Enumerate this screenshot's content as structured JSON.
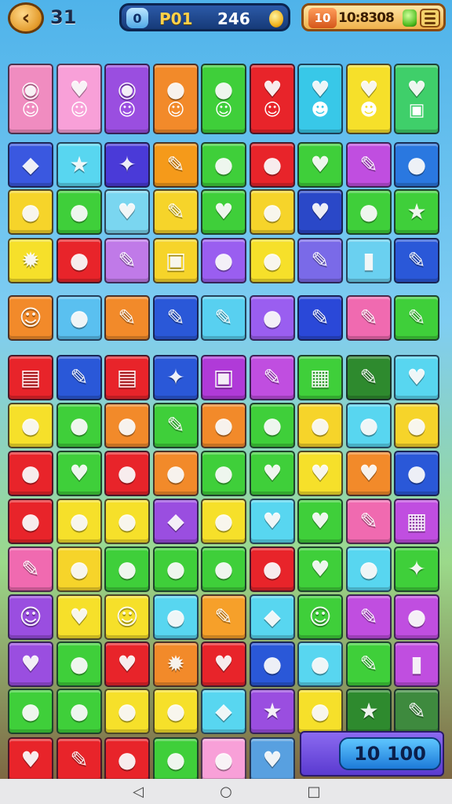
{
  "hud": {
    "level": "31",
    "mode_badge": "0",
    "mode_label": "P01",
    "score": "246",
    "timer_badge": "10",
    "timer": "10:8308",
    "back_icon": "back-arrow-icon",
    "coin_icon": "coin-icon",
    "gem_icon": "gem-icon",
    "menu_icon": "menu-icon"
  },
  "board": {
    "row_tops": [
      0,
      100,
      160,
      222,
      295,
      371,
      432,
      493,
      554,
      615,
      676,
      736,
      796,
      858
    ],
    "rows": [
      [
        {
          "color": "#f08cc0",
          "glyph": "◉",
          "face": "☺",
          "tall": true
        },
        {
          "color": "#f8a0d8",
          "glyph": "♥",
          "face": "☺",
          "tall": true
        },
        {
          "color": "#9a4ee0",
          "glyph": "◉",
          "face": "☺",
          "tall": true
        },
        {
          "color": "#f28a2a",
          "glyph": "●",
          "face": "☺",
          "tall": true
        },
        {
          "color": "#3fcf3a",
          "glyph": "●",
          "face": "☺",
          "tall": true
        },
        {
          "color": "#e8242a",
          "glyph": "♥",
          "face": "☺",
          "tall": true
        },
        {
          "color": "#38c8e8",
          "glyph": "♥",
          "face": "☻",
          "tall": true
        },
        {
          "color": "#f6e02a",
          "glyph": "♥",
          "face": "☻",
          "tall": true
        },
        {
          "color": "#3fcf6a",
          "glyph": "♥",
          "face": "▣",
          "tall": true
        }
      ],
      [
        {
          "color": "#3a58e0",
          "glyph": "◆"
        },
        {
          "color": "#58d6f0",
          "glyph": "★"
        },
        {
          "color": "#4a3ad8",
          "glyph": "✦"
        },
        {
          "color": "#f59a1a",
          "glyph": "✎"
        },
        {
          "color": "#3fcf3a",
          "glyph": "●"
        },
        {
          "color": "#e8242a",
          "glyph": "●"
        },
        {
          "color": "#3fcf3a",
          "glyph": "♥"
        },
        {
          "color": "#c04ee0",
          "glyph": "✎"
        },
        {
          "color": "#2a78e0",
          "glyph": "●"
        }
      ],
      [
        {
          "color": "#f6d42a",
          "glyph": "●"
        },
        {
          "color": "#3fcf3a",
          "glyph": "●"
        },
        {
          "color": "#7ad6f0",
          "glyph": "♥"
        },
        {
          "color": "#f6d42a",
          "glyph": "✎"
        },
        {
          "color": "#3fcf3a",
          "glyph": "♥"
        },
        {
          "color": "#f6d42a",
          "glyph": "●"
        },
        {
          "color": "#2a48c8",
          "glyph": "♥"
        },
        {
          "color": "#3fcf3a",
          "glyph": "●"
        },
        {
          "color": "#3fcf3a",
          "glyph": "★"
        }
      ],
      [
        {
          "color": "#f6e02a",
          "glyph": "✹"
        },
        {
          "color": "#e8242a",
          "glyph": "●"
        },
        {
          "color": "#c07ae8",
          "glyph": "✎"
        },
        {
          "color": "#f6d42a",
          "glyph": "▣"
        },
        {
          "color": "#9a5ef0",
          "glyph": "●"
        },
        {
          "color": "#f6e02a",
          "glyph": "●"
        },
        {
          "color": "#7a6ae8",
          "glyph": "✎"
        },
        {
          "color": "#6ad0f0",
          "glyph": "▮"
        },
        {
          "color": "#2a58d8",
          "glyph": "✎"
        }
      ],
      [
        {
          "color": "#f28a2a",
          "glyph": "☺"
        },
        {
          "color": "#5ac0f0",
          "glyph": "●"
        },
        {
          "color": "#f28a2a",
          "glyph": "✎"
        },
        {
          "color": "#2a58d8",
          "glyph": "✎"
        },
        {
          "color": "#58d0f0",
          "glyph": "✎"
        },
        {
          "color": "#9a5ef0",
          "glyph": "●"
        },
        {
          "color": "#2a48d8",
          "glyph": "✎"
        },
        {
          "color": "#f06ab0",
          "glyph": "✎"
        },
        {
          "color": "#3fcf3a",
          "glyph": "✎"
        }
      ],
      [
        {
          "color": "#e8242a",
          "glyph": "▤"
        },
        {
          "color": "#2a58d8",
          "glyph": "✎"
        },
        {
          "color": "#e8242a",
          "glyph": "▤"
        },
        {
          "color": "#2a58d8",
          "glyph": "✦"
        },
        {
          "color": "#b03ad8",
          "glyph": "▣"
        },
        {
          "color": "#c04ee0",
          "glyph": "✎"
        },
        {
          "color": "#3fcf3a",
          "glyph": "▦"
        },
        {
          "color": "#2e8a2e",
          "glyph": "✎"
        },
        {
          "color": "#58d6f0",
          "glyph": "♥"
        }
      ],
      [
        {
          "color": "#f6e02a",
          "glyph": "●"
        },
        {
          "color": "#3fcf3a",
          "glyph": "●"
        },
        {
          "color": "#f28a2a",
          "glyph": "●"
        },
        {
          "color": "#3fcf3a",
          "glyph": "✎"
        },
        {
          "color": "#f28a2a",
          "glyph": "●"
        },
        {
          "color": "#3fcf3a",
          "glyph": "●"
        },
        {
          "color": "#f6d42a",
          "glyph": "●"
        },
        {
          "color": "#58d6f0",
          "glyph": "●"
        },
        {
          "color": "#f6d42a",
          "glyph": "●"
        }
      ],
      [
        {
          "color": "#e8242a",
          "glyph": "●"
        },
        {
          "color": "#3fcf3a",
          "glyph": "♥"
        },
        {
          "color": "#e8242a",
          "glyph": "●"
        },
        {
          "color": "#f28a2a",
          "glyph": "●"
        },
        {
          "color": "#3fcf3a",
          "glyph": "●"
        },
        {
          "color": "#3fcf3a",
          "glyph": "♥"
        },
        {
          "color": "#f6e02a",
          "glyph": "♥"
        },
        {
          "color": "#f28a2a",
          "glyph": "♥"
        },
        {
          "color": "#2a58d8",
          "glyph": "●"
        }
      ],
      [
        {
          "color": "#e8242a",
          "glyph": "●"
        },
        {
          "color": "#f6e02a",
          "glyph": "●"
        },
        {
          "color": "#f6e02a",
          "glyph": "●"
        },
        {
          "color": "#9a4ee0",
          "glyph": "◆"
        },
        {
          "color": "#f6e02a",
          "glyph": "●"
        },
        {
          "color": "#58d6f0",
          "glyph": "♥"
        },
        {
          "color": "#3fcf3a",
          "glyph": "♥"
        },
        {
          "color": "#f06ab0",
          "glyph": "✎"
        },
        {
          "color": "#c04ee0",
          "glyph": "▦"
        }
      ],
      [
        {
          "color": "#f06ab0",
          "glyph": "✎"
        },
        {
          "color": "#f6d42a",
          "glyph": "●"
        },
        {
          "color": "#3fcf3a",
          "glyph": "●"
        },
        {
          "color": "#3fcf3a",
          "glyph": "●"
        },
        {
          "color": "#3fcf3a",
          "glyph": "●"
        },
        {
          "color": "#e8242a",
          "glyph": "●"
        },
        {
          "color": "#3fcf3a",
          "glyph": "♥"
        },
        {
          "color": "#58d6f0",
          "glyph": "●"
        },
        {
          "color": "#3fcf3a",
          "glyph": "✦"
        }
      ],
      [
        {
          "color": "#9a4ee0",
          "glyph": "☺"
        },
        {
          "color": "#f6e02a",
          "glyph": "♥"
        },
        {
          "color": "#f6e02a",
          "glyph": "☺"
        },
        {
          "color": "#58d6f0",
          "glyph": "●"
        },
        {
          "color": "#f6a02a",
          "glyph": "✎"
        },
        {
          "color": "#58d6f0",
          "glyph": "◆"
        },
        {
          "color": "#3fcf3a",
          "glyph": "☺"
        },
        {
          "color": "#c04ee0",
          "glyph": "✎"
        },
        {
          "color": "#c04ee0",
          "glyph": "●"
        }
      ],
      [
        {
          "color": "#9a4ee0",
          "glyph": "♥"
        },
        {
          "color": "#3fcf3a",
          "glyph": "●"
        },
        {
          "color": "#e8242a",
          "glyph": "♥"
        },
        {
          "color": "#f28a2a",
          "glyph": "✹"
        },
        {
          "color": "#e8242a",
          "glyph": "♥"
        },
        {
          "color": "#2a58d8",
          "glyph": "●"
        },
        {
          "color": "#58d6f0",
          "glyph": "●"
        },
        {
          "color": "#3fcf3a",
          "glyph": "✎"
        },
        {
          "color": "#c04ee0",
          "glyph": "▮"
        }
      ],
      [
        {
          "color": "#3fcf3a",
          "glyph": "●"
        },
        {
          "color": "#3fcf3a",
          "glyph": "●"
        },
        {
          "color": "#f6e02a",
          "glyph": "●"
        },
        {
          "color": "#f6e02a",
          "glyph": "●"
        },
        {
          "color": "#58d6f0",
          "glyph": "◆"
        },
        {
          "color": "#9a4ee0",
          "glyph": "★"
        },
        {
          "color": "#f6e02a",
          "glyph": "●"
        },
        {
          "color": "#2e8a2e",
          "glyph": "★"
        },
        {
          "color": "#3e8a3e",
          "glyph": "✎"
        }
      ],
      [
        {
          "color": "#e8242a",
          "glyph": "♥"
        },
        {
          "color": "#e8242a",
          "glyph": "✎"
        },
        {
          "color": "#e8242a",
          "glyph": "●"
        },
        {
          "color": "#3fcf3a",
          "glyph": "●"
        },
        {
          "color": "#f8a0d8",
          "glyph": "●"
        },
        {
          "color": "#58a0e0",
          "glyph": "♥"
        }
      ]
    ]
  },
  "bottom_counter": "10 100",
  "nav": {
    "back": "◁",
    "home": "○",
    "recents": "□"
  }
}
